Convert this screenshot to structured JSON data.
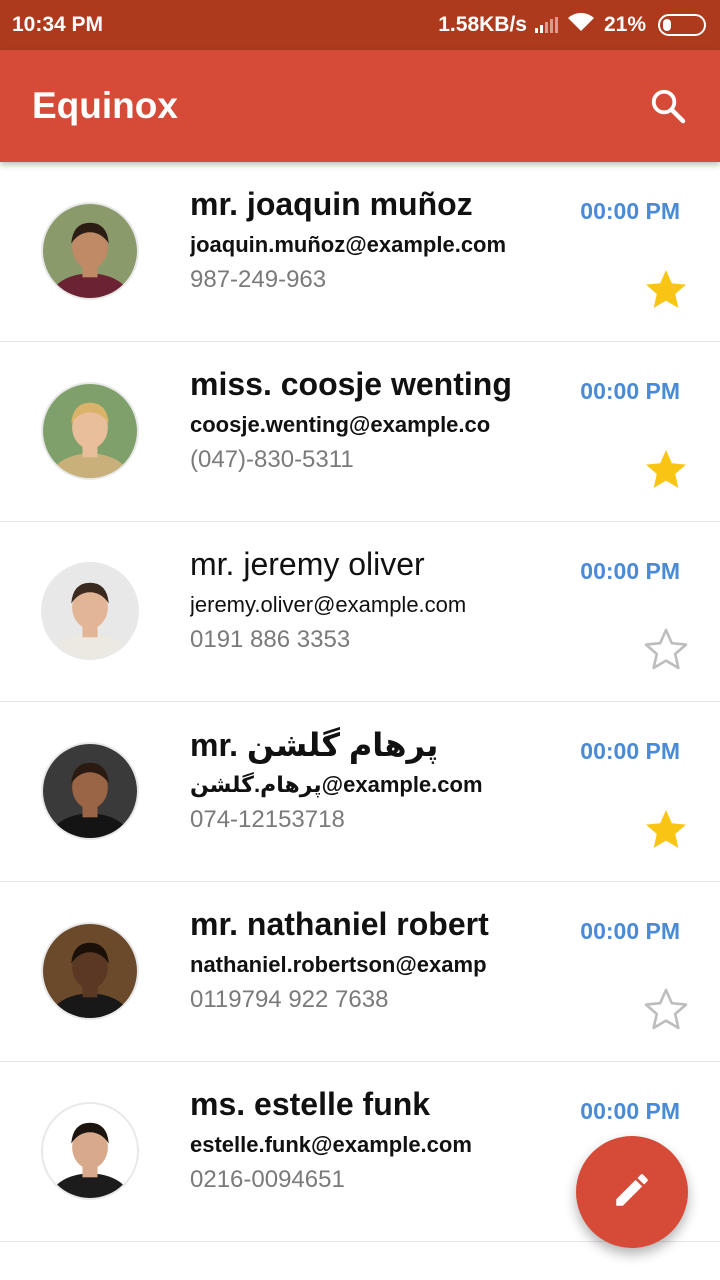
{
  "status_bar": {
    "time": "10:34 PM",
    "network_speed": "1.58KB/s",
    "battery_percent": "21%",
    "battery_level": 0.21,
    "icons": [
      "signal-icon",
      "wifi-icon",
      "battery-icon"
    ]
  },
  "app_bar": {
    "title": "Equinox",
    "search_icon": "search-icon"
  },
  "colors": {
    "app_bar": "#d64b38",
    "status_bar": "#ad3a1c",
    "time_text": "#4a8ad6",
    "star_filled": "#f8c514",
    "star_empty": "#bdbdbd"
  },
  "contacts": [
    {
      "name": "mr. joaquin muñoz",
      "email": "joaquin.muñoz@example.com",
      "phone": "987-249-963",
      "time": "00:00 PM",
      "starred": true,
      "bold": true
    },
    {
      "name": "miss. coosje wenting",
      "email": "coosje.wenting@example.co",
      "phone": "(047)-830-5311",
      "time": "00:00 PM",
      "starred": true,
      "bold": true
    },
    {
      "name": "mr. jeremy oliver",
      "email": "jeremy.oliver@example.com",
      "phone": "0191 886 3353",
      "time": "00:00 PM",
      "starred": false,
      "bold": false
    },
    {
      "name": "mr. پرهام گلشن",
      "email": "پرهام.گلشن@example.com",
      "phone": "074-12153718",
      "time": "00:00 PM",
      "starred": true,
      "bold": true
    },
    {
      "name": "mr. nathaniel robert",
      "email": "nathaniel.robertson@examp",
      "phone": "0119794 922 7638",
      "time": "00:00 PM",
      "starred": false,
      "bold": true
    },
    {
      "name": "ms. estelle funk",
      "email": "estelle.funk@example.com",
      "phone": "0216-0094651",
      "time": "00:00 PM",
      "starred": false,
      "bold": true
    }
  ],
  "fab": {
    "icon": "pencil-icon"
  }
}
